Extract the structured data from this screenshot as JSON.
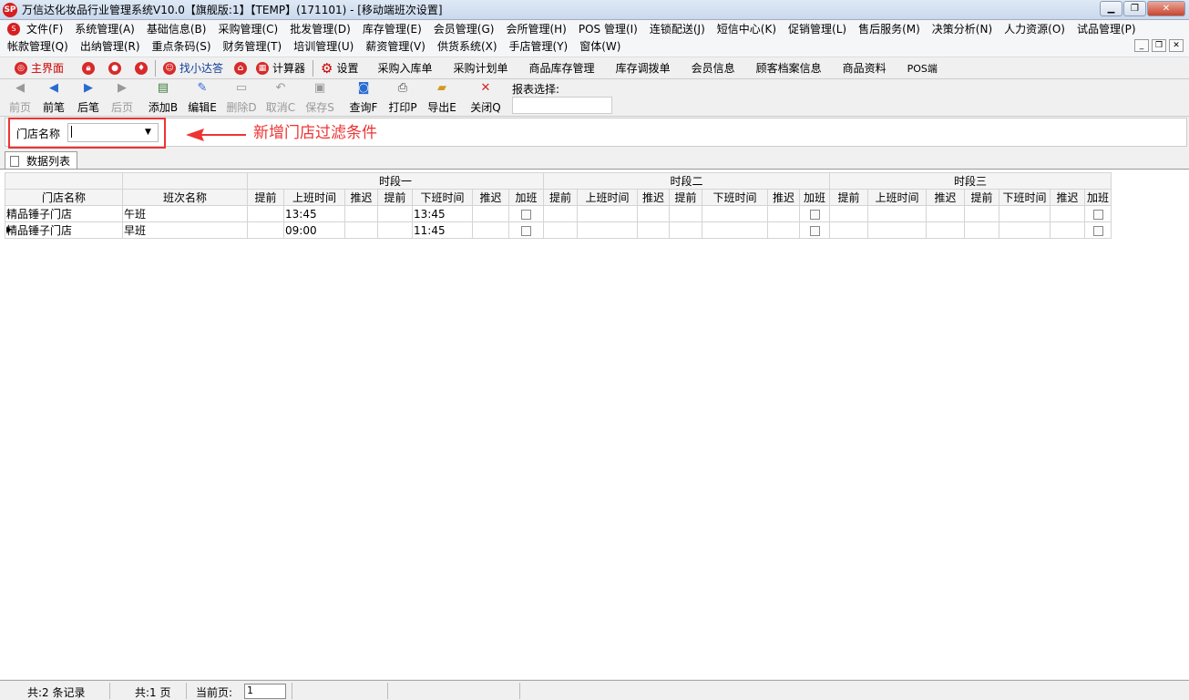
{
  "window": {
    "title": "万信达化妆品行业管理系统V10.0【旗舰版:1】【TEMP】(171101) - [移动端班次设置]",
    "logo_text": "SP"
  },
  "menu": {
    "row1": [
      "文件(F)",
      "系统管理(A)",
      "基础信息(B)",
      "采购管理(C)",
      "批发管理(D)",
      "库存管理(E)",
      "会员管理(G)",
      "会所管理(H)",
      "POS 管理(I)",
      "连锁配送(J)",
      "短信中心(K)",
      "促销管理(L)",
      "售后服务(M)",
      "决策分析(N)",
      "人力资源(O)",
      "试品管理(P)"
    ],
    "row2": [
      "帐款管理(Q)",
      "出纳管理(R)",
      "重点条码(S)",
      "财务管理(T)",
      "培训管理(U)",
      "薪资管理(V)",
      "供货系统(X)",
      "手店管理(Y)",
      "窗体(W)"
    ]
  },
  "quickbar": {
    "home": "主界面",
    "xiaoda": "找小达答",
    "calculator": "计算器",
    "settings": "设置",
    "links": [
      "采购入库单",
      "采购计划单",
      "商品库存管理",
      "库存调拨单",
      "会员信息",
      "顾客档案信息",
      "商品资料",
      "POS端"
    ]
  },
  "toolbar": {
    "first": "前页",
    "prev": "前笔",
    "next": "后笔",
    "last": "后页",
    "add": "添加B",
    "edit": "编辑E",
    "delete": "删除D",
    "cancel": "取消C",
    "save": "保存S",
    "query": "查询F",
    "print": "打印P",
    "export": "导出E",
    "close": "关闭Q",
    "report_label": "报表选择:"
  },
  "filter": {
    "label": "门店名称",
    "value": "",
    "annotation": "新增门店过滤条件"
  },
  "tab": {
    "label": "数据列表"
  },
  "grid": {
    "group_headers": [
      "时段一",
      "时段二",
      "时段三"
    ],
    "col_store": "门店名称",
    "col_shift": "班次名称",
    "period_cols": [
      "提前",
      "上班时间",
      "推迟",
      "提前",
      "下班时间",
      "推迟",
      "加班"
    ],
    "rows": [
      {
        "store": "精品锤子门店",
        "shift": "午班",
        "on1": "13:45",
        "off1": "13:45"
      },
      {
        "store": "精品锤子门店",
        "shift": "早班",
        "on1": "09:00",
        "off1": "11:45"
      }
    ]
  },
  "status": {
    "records": "共:2 条记录",
    "pages": "共:1 页",
    "current_label": "当前页:",
    "current_page": "1"
  }
}
